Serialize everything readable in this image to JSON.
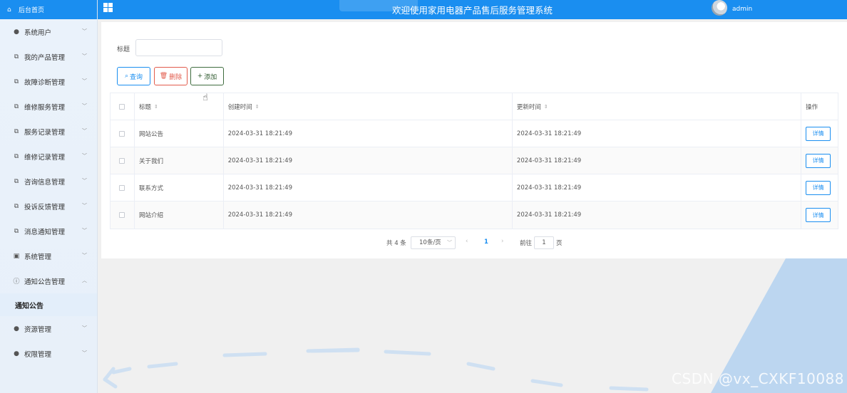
{
  "topbar": {
    "title": "欢迎使用家用电器产品售后服务管理系统",
    "user": "admin"
  },
  "sidebar": {
    "home": "后台首页",
    "items": [
      {
        "label": "系统用户",
        "icon": "user-icon"
      },
      {
        "label": "我的产品管理",
        "icon": "external-link-icon"
      },
      {
        "label": "故障诊断管理",
        "icon": "external-link-icon"
      },
      {
        "label": "维修服务管理",
        "icon": "external-link-icon"
      },
      {
        "label": "服务记录管理",
        "icon": "external-link-icon"
      },
      {
        "label": "维修记录管理",
        "icon": "external-link-icon"
      },
      {
        "label": "咨询信息管理",
        "icon": "external-link-icon"
      },
      {
        "label": "投诉反馈管理",
        "icon": "external-link-icon"
      },
      {
        "label": "消息通知管理",
        "icon": "external-link-icon"
      },
      {
        "label": "系统管理",
        "icon": "image-icon"
      },
      {
        "label": "通知公告管理",
        "icon": "info-circle-icon"
      }
    ],
    "active_sub": "通知公告",
    "items_after": [
      {
        "label": "资源管理",
        "icon": "location-icon"
      },
      {
        "label": "权限管理",
        "icon": "user-icon"
      }
    ]
  },
  "search": {
    "label": "标题",
    "value": ""
  },
  "buttons": {
    "query": "查询",
    "delete": "删除",
    "add": "添加"
  },
  "table": {
    "headers": {
      "title": "标题",
      "created": "创建时间",
      "updated": "更新时间",
      "op": "操作"
    },
    "rows": [
      {
        "title": "网站公告",
        "created": "2024-03-31 18:21:49",
        "updated": "2024-03-31 18:21:49",
        "action": "详情"
      },
      {
        "title": "关于我们",
        "created": "2024-03-31 18:21:49",
        "updated": "2024-03-31 18:21:49",
        "action": "详情"
      },
      {
        "title": "联系方式",
        "created": "2024-03-31 18:21:49",
        "updated": "2024-03-31 18:21:49",
        "action": "详情"
      },
      {
        "title": "网站介绍",
        "created": "2024-03-31 18:21:49",
        "updated": "2024-03-31 18:21:49",
        "action": "详情"
      }
    ]
  },
  "pagination": {
    "total": "共 4 条",
    "page_size": "10条/页",
    "current": "1",
    "goto_label": "前往",
    "goto_value": "1",
    "page_suffix": "页"
  },
  "watermark": "CSDN @vx_CXKF10088",
  "colors": {
    "primary": "#1a8ef0",
    "danger": "#e25b4c",
    "add": "#3f6d3f"
  }
}
